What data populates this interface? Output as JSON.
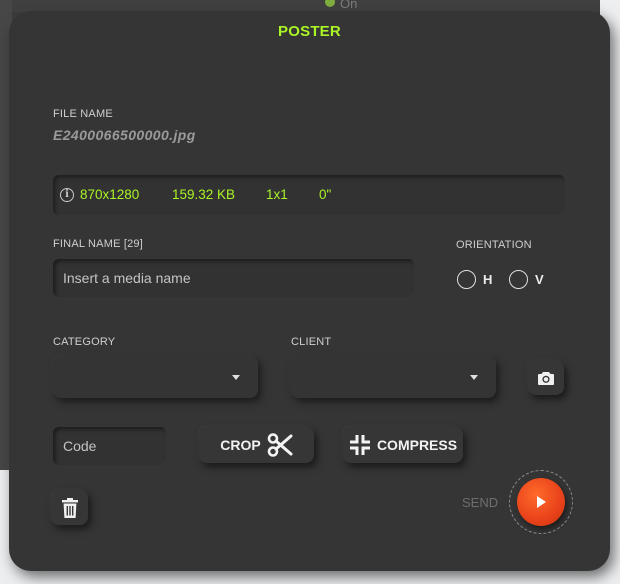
{
  "background": {
    "behind_label": "On"
  },
  "panel": {
    "title": "POSTER",
    "accent_color": "#aaf526",
    "send_color": "#e8421a"
  },
  "file": {
    "label": "FILE NAME",
    "value": "E2400066500000.jpg"
  },
  "info": {
    "icon": "info-icon",
    "dimensions": "870x1280",
    "size": "159.32 KB",
    "ratio": "1x1",
    "duration": "0\""
  },
  "final_name": {
    "label": "FINAL NAME [29]",
    "placeholder": "Insert a media name",
    "value": ""
  },
  "orientation": {
    "label": "ORIENTATION",
    "options": [
      "H",
      "V"
    ]
  },
  "category": {
    "label": "CATEGORY",
    "value": ""
  },
  "client": {
    "label": "CLIENT",
    "value": ""
  },
  "code": {
    "placeholder": "Code",
    "value": ""
  },
  "buttons": {
    "crop": "CROP",
    "compress": "COMPRESS",
    "send": "SEND",
    "camera_icon": "camera-icon",
    "delete_icon": "trash-icon",
    "crop_icon": "scissors-icon",
    "compress_icon": "compress-icon",
    "send_icon": "play-icon"
  }
}
